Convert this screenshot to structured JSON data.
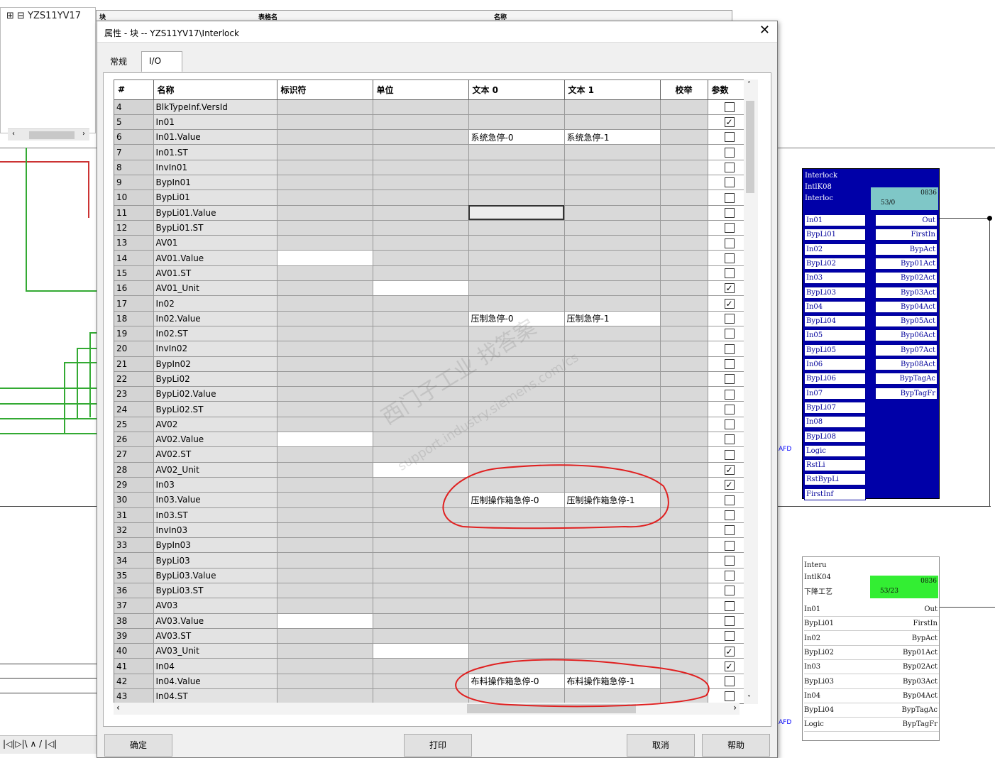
{
  "tree": {
    "root_label": "YZS11YV17"
  },
  "top_headers": [
    "块",
    "表格名",
    "名称"
  ],
  "bottom_bar": "|◁|▷|\\ ∧ / |◁|",
  "dialog": {
    "title": "属性 - 块 -- YZS11YV17\\Interlock",
    "close": "✕",
    "tabs": [
      "常规",
      "I/O"
    ],
    "columns": [
      "#",
      "名称",
      "标识符",
      "单位",
      "文本 0",
      "文本 1",
      "校举",
      "参数"
    ],
    "rows": [
      {
        "no": "4",
        "name": "BlkTypeInf.VersId",
        "t0": "",
        "t1": "",
        "chk": false,
        "rowcls": ""
      },
      {
        "no": "5",
        "name": "In01",
        "t0": "",
        "t1": "",
        "chk": true,
        "rowcls": ""
      },
      {
        "no": "6",
        "name": "In01.Value",
        "t0": "系统急停-0",
        "t1": "系统急停-1",
        "chk": false,
        "rowcls": "txt"
      },
      {
        "no": "7",
        "name": "In01.ST",
        "t0": "",
        "t1": "",
        "chk": false,
        "rowcls": ""
      },
      {
        "no": "8",
        "name": "InvIn01",
        "t0": "",
        "t1": "",
        "chk": false,
        "rowcls": ""
      },
      {
        "no": "9",
        "name": "BypIn01",
        "t0": "",
        "t1": "",
        "chk": false,
        "rowcls": ""
      },
      {
        "no": "10",
        "name": "BypLi01",
        "t0": "",
        "t1": "",
        "chk": false,
        "rowcls": ""
      },
      {
        "no": "11",
        "name": "BypLi01.Value",
        "t0": "",
        "t1": "",
        "chk": false,
        "rowcls": "sel"
      },
      {
        "no": "12",
        "name": "BypLi01.ST",
        "t0": "",
        "t1": "",
        "chk": false,
        "rowcls": ""
      },
      {
        "no": "13",
        "name": "AV01",
        "t0": "",
        "t1": "",
        "chk": false,
        "rowcls": ""
      },
      {
        "no": "14",
        "name": "AV01.Value",
        "t0": "",
        "t1": "",
        "chk": false,
        "rowcls": "id"
      },
      {
        "no": "15",
        "name": "AV01.ST",
        "t0": "",
        "t1": "",
        "chk": false,
        "rowcls": ""
      },
      {
        "no": "16",
        "name": "AV01_Unit",
        "t0": "",
        "t1": "",
        "chk": true,
        "rowcls": "unit"
      },
      {
        "no": "17",
        "name": "In02",
        "t0": "",
        "t1": "",
        "chk": true,
        "rowcls": ""
      },
      {
        "no": "18",
        "name": "In02.Value",
        "t0": "压制急停-0",
        "t1": "压制急停-1",
        "chk": false,
        "rowcls": "txt"
      },
      {
        "no": "19",
        "name": "In02.ST",
        "t0": "",
        "t1": "",
        "chk": false,
        "rowcls": ""
      },
      {
        "no": "20",
        "name": "InvIn02",
        "t0": "",
        "t1": "",
        "chk": false,
        "rowcls": ""
      },
      {
        "no": "21",
        "name": "BypIn02",
        "t0": "",
        "t1": "",
        "chk": false,
        "rowcls": ""
      },
      {
        "no": "22",
        "name": "BypLi02",
        "t0": "",
        "t1": "",
        "chk": false,
        "rowcls": ""
      },
      {
        "no": "23",
        "name": "BypLi02.Value",
        "t0": "",
        "t1": "",
        "chk": false,
        "rowcls": ""
      },
      {
        "no": "24",
        "name": "BypLi02.ST",
        "t0": "",
        "t1": "",
        "chk": false,
        "rowcls": ""
      },
      {
        "no": "25",
        "name": "AV02",
        "t0": "",
        "t1": "",
        "chk": false,
        "rowcls": ""
      },
      {
        "no": "26",
        "name": "AV02.Value",
        "t0": "",
        "t1": "",
        "chk": false,
        "rowcls": "id"
      },
      {
        "no": "27",
        "name": "AV02.ST",
        "t0": "",
        "t1": "",
        "chk": false,
        "rowcls": ""
      },
      {
        "no": "28",
        "name": "AV02_Unit",
        "t0": "",
        "t1": "",
        "chk": true,
        "rowcls": "unit"
      },
      {
        "no": "29",
        "name": "In03",
        "t0": "",
        "t1": "",
        "chk": true,
        "rowcls": ""
      },
      {
        "no": "30",
        "name": "In03.Value",
        "t0": "压制操作箱急停-0",
        "t1": "压制操作箱急停-1",
        "chk": false,
        "rowcls": "txt"
      },
      {
        "no": "31",
        "name": "In03.ST",
        "t0": "",
        "t1": "",
        "chk": false,
        "rowcls": ""
      },
      {
        "no": "32",
        "name": "InvIn03",
        "t0": "",
        "t1": "",
        "chk": false,
        "rowcls": ""
      },
      {
        "no": "33",
        "name": "BypIn03",
        "t0": "",
        "t1": "",
        "chk": false,
        "rowcls": ""
      },
      {
        "no": "34",
        "name": "BypLi03",
        "t0": "",
        "t1": "",
        "chk": false,
        "rowcls": ""
      },
      {
        "no": "35",
        "name": "BypLi03.Value",
        "t0": "",
        "t1": "",
        "chk": false,
        "rowcls": ""
      },
      {
        "no": "36",
        "name": "BypLi03.ST",
        "t0": "",
        "t1": "",
        "chk": false,
        "rowcls": ""
      },
      {
        "no": "37",
        "name": "AV03",
        "t0": "",
        "t1": "",
        "chk": false,
        "rowcls": ""
      },
      {
        "no": "38",
        "name": "AV03.Value",
        "t0": "",
        "t1": "",
        "chk": false,
        "rowcls": "id"
      },
      {
        "no": "39",
        "name": "AV03.ST",
        "t0": "",
        "t1": "",
        "chk": false,
        "rowcls": ""
      },
      {
        "no": "40",
        "name": "AV03_Unit",
        "t0": "",
        "t1": "",
        "chk": true,
        "rowcls": "unit"
      },
      {
        "no": "41",
        "name": "In04",
        "t0": "",
        "t1": "",
        "chk": true,
        "rowcls": ""
      },
      {
        "no": "42",
        "name": "In04.Value",
        "t0": "布料操作箱急停-0",
        "t1": "布料操作箱急停-1",
        "chk": false,
        "rowcls": "txt"
      },
      {
        "no": "43",
        "name": "In04.ST",
        "t0": "",
        "t1": "",
        "chk": false,
        "rowcls": ""
      }
    ],
    "buttons": {
      "ok": "确定",
      "print": "打印",
      "cancel": "取消",
      "help": "帮助"
    }
  },
  "watermark": {
    "line1": "西门子工业  找答案",
    "line2": "support.industry.siemens.com/cs"
  },
  "block1": {
    "title_lines": [
      "Interlock",
      "IntlK08",
      "Interloc"
    ],
    "badge_top": "0836",
    "badge_bottom": "53/0",
    "inputs": [
      "In01",
      "BypLi01",
      "In02",
      "BypLi02",
      "In03",
      "BypLi03",
      "In04",
      "BypLi04",
      "In05",
      "BypLi05",
      "In06",
      "BypLi06",
      "In07",
      "BypLi07",
      "In08",
      "BypLi08",
      "Logic",
      "RstLi",
      "RstBypLi",
      "FirstInf"
    ],
    "outputs": [
      "Out",
      "FirstIn",
      "BypAct",
      "Byp01Act",
      "Byp02Act",
      "Byp03Act",
      "Byp04Act",
      "Byp05Act",
      "Byp06Act",
      "Byp07Act",
      "Byp08Act",
      "BypTagAc",
      "BypTagFr"
    ],
    "logic_tag": "AFD"
  },
  "block2": {
    "title_lines": [
      "Interu",
      "IntlK04",
      "下降工艺"
    ],
    "badge_top": "0836",
    "badge_bottom": "53/23",
    "rows": [
      {
        "l": "In01",
        "r": "Out"
      },
      {
        "l": "BypLi01",
        "r": "FirstIn"
      },
      {
        "l": "In02",
        "r": "BypAct"
      },
      {
        "l": "BypLi02",
        "r": "Byp01Act"
      },
      {
        "l": "In03",
        "r": "Byp02Act"
      },
      {
        "l": "BypLi03",
        "r": "Byp03Act"
      },
      {
        "l": "In04",
        "r": "Byp04Act"
      },
      {
        "l": "BypLi04",
        "r": "BypTagAc"
      },
      {
        "l": "Logic",
        "r": "BypTagFr"
      }
    ],
    "logic_tag": "AFD"
  }
}
